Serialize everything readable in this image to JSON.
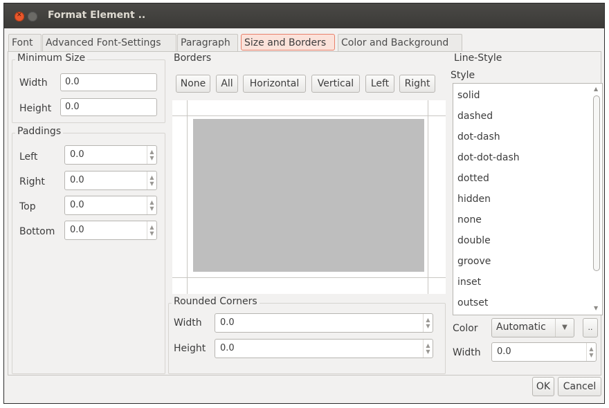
{
  "window": {
    "title": "Format Element .."
  },
  "tabs": [
    {
      "label": "Font"
    },
    {
      "label": "Advanced Font-Settings"
    },
    {
      "label": "Paragraph"
    },
    {
      "label": "Size and Borders"
    },
    {
      "label": "Color and Background"
    }
  ],
  "min_size": {
    "title": "Minimum Size",
    "width_label": "Width",
    "width_value": "0.0",
    "height_label": "Height",
    "height_value": "0.0"
  },
  "paddings": {
    "title": "Paddings",
    "left_label": "Left",
    "left_value": "0.0",
    "right_label": "Right",
    "right_value": "0.0",
    "top_label": "Top",
    "top_value": "0.0",
    "bottom_label": "Bottom",
    "bottom_value": "0.0"
  },
  "borders": {
    "title": "Borders",
    "buttons": [
      "None",
      "All",
      "Horizontal",
      "Vertical",
      "Left",
      "Right"
    ]
  },
  "rounded": {
    "title": "Rounded Corners",
    "width_label": "Width",
    "width_value": "0.0",
    "height_label": "Height",
    "height_value": "0.0"
  },
  "line_style": {
    "title": "Line-Style",
    "style_label": "Style",
    "styles": [
      "solid",
      "dashed",
      "dot-dash",
      "dot-dot-dash",
      "dotted",
      "hidden",
      "none",
      "double",
      "groove",
      "inset",
      "outset"
    ],
    "color_label": "Color",
    "color_value": "Automatic",
    "color_more": "..",
    "width_label": "Width",
    "width_value": "0.0"
  },
  "footer": {
    "ok": "OK",
    "cancel": "Cancel"
  },
  "colors": {
    "accent_tab_bg": "#fbe2da",
    "accent_tab_border": "#e8806a",
    "close_button": "#e9572c",
    "titlebar": "#3b3a37"
  }
}
